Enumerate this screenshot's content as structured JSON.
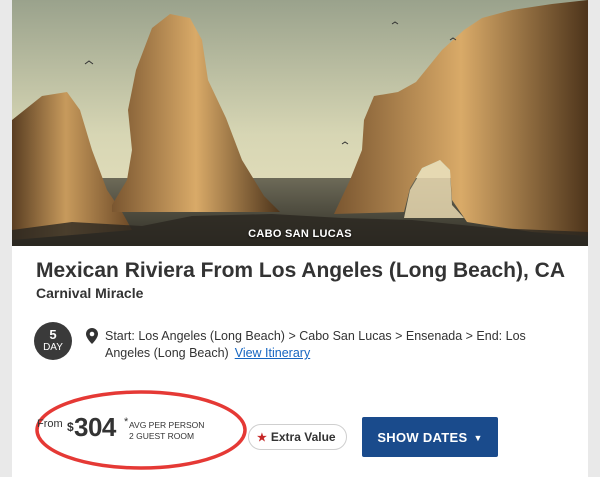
{
  "hero": {
    "caption": "CABO SAN LUCAS"
  },
  "cruise": {
    "title": "Mexican Riviera From Los Angeles (Long Beach), CA",
    "ship": "Carnival Miracle",
    "duration_number": "5",
    "duration_unit": "DAY",
    "itinerary_text": "Start: Los Angeles (Long Beach) > Cabo San Lucas > Ensenada > End: Los Angeles (Long Beach)",
    "itinerary_link": "View Itinerary"
  },
  "price": {
    "from_label": "From",
    "currency": "$",
    "amount": "304",
    "asterisk": "*",
    "avg_line1": "AVG PER PERSON",
    "avg_line2": "2 GUEST ROOM"
  },
  "badges": {
    "extra_value": "Extra Value"
  },
  "actions": {
    "show_dates": "SHOW DATES"
  },
  "colors": {
    "primary_button": "#1a4b8c",
    "link": "#1565c0",
    "annotation_circle": "#e53935",
    "star": "#c62828"
  },
  "icons": [
    "location-pin-icon",
    "star-icon",
    "chevron-down-icon"
  ]
}
